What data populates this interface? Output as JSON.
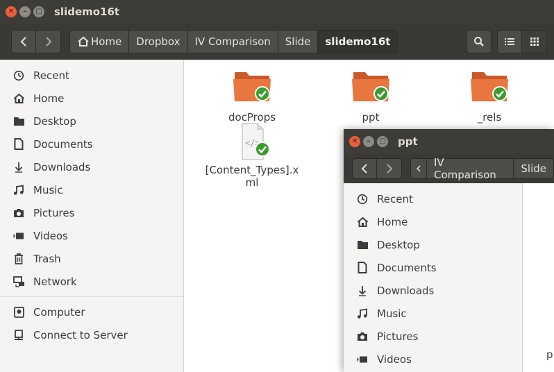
{
  "main_window": {
    "title": "slidemo16t",
    "breadcrumbs": [
      "Home",
      "Dropbox",
      "IV Comparison",
      "Slide",
      "slidemo16t"
    ],
    "sidebar_items": [
      {
        "label": "Recent",
        "icon": "clock-icon"
      },
      {
        "label": "Home",
        "icon": "home-icon"
      },
      {
        "label": "Desktop",
        "icon": "folder-icon"
      },
      {
        "label": "Documents",
        "icon": "document-icon"
      },
      {
        "label": "Downloads",
        "icon": "download-icon"
      },
      {
        "label": "Music",
        "icon": "music-icon"
      },
      {
        "label": "Pictures",
        "icon": "camera-icon"
      },
      {
        "label": "Videos",
        "icon": "video-icon"
      },
      {
        "label": "Trash",
        "icon": "trash-icon"
      },
      {
        "label": "Network",
        "icon": "network-icon"
      },
      {
        "label": "Computer",
        "icon": "computer-icon"
      },
      {
        "label": "Connect to Server",
        "icon": "server-icon"
      }
    ],
    "files": [
      {
        "name": "docProps",
        "type": "folder"
      },
      {
        "name": "ppt",
        "type": "folder"
      },
      {
        "name": "_rels",
        "type": "folder"
      },
      {
        "name": "[Content_Types].xml",
        "type": "xml"
      }
    ]
  },
  "second_window": {
    "title": "ppt",
    "breadcrumbs": [
      "IV Comparison",
      "Slide"
    ],
    "sidebar_items": [
      {
        "label": "Recent",
        "icon": "clock-icon"
      },
      {
        "label": "Home",
        "icon": "home-icon"
      },
      {
        "label": "Desktop",
        "icon": "folder-icon"
      },
      {
        "label": "Documents",
        "icon": "document-icon"
      },
      {
        "label": "Downloads",
        "icon": "download-icon"
      },
      {
        "label": "Music",
        "icon": "music-icon"
      },
      {
        "label": "Pictures",
        "icon": "camera-icon"
      },
      {
        "label": "Videos",
        "icon": "video-icon"
      }
    ],
    "partial_text": "p"
  },
  "colors": {
    "titlebar": "#3d3c37",
    "folder_orange": "#e9753f",
    "sync_green": "#3c9b2f",
    "close_button": "#e95f3c"
  }
}
